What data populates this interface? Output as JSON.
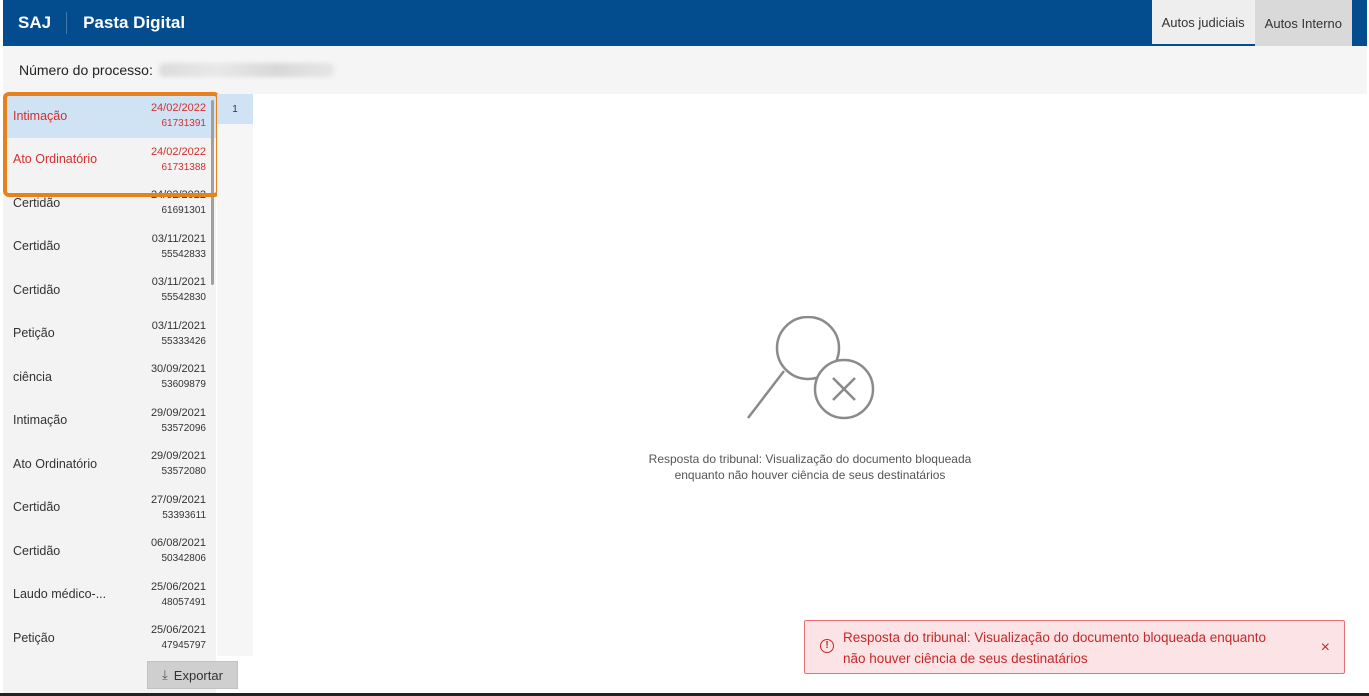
{
  "header": {
    "brand": "SAJ",
    "title": "Pasta Digital",
    "tabs": [
      {
        "label": "Autos judiciais",
        "active": true
      },
      {
        "label": "Autos Interno",
        "active": false
      }
    ],
    "color": "#034d8e"
  },
  "process": {
    "label": "Número do processo:",
    "value_redacted": true
  },
  "documents": [
    {
      "label": "Intimação",
      "date": "24/02/2022",
      "id": "61731391",
      "selected": true,
      "red": true
    },
    {
      "label": "Ato Ordinatório",
      "date": "24/02/2022",
      "id": "61731388",
      "selected": false,
      "red": true
    },
    {
      "label": "Certidão",
      "date": "24/02/2022",
      "id": "61691301",
      "selected": false,
      "red": false
    },
    {
      "label": "Certidão",
      "date": "03/11/2021",
      "id": "55542833",
      "selected": false,
      "red": false
    },
    {
      "label": "Certidão",
      "date": "03/11/2021",
      "id": "55542830",
      "selected": false,
      "red": false
    },
    {
      "label": "Petição",
      "date": "03/11/2021",
      "id": "55333426",
      "selected": false,
      "red": false
    },
    {
      "label": "ciência",
      "date": "30/09/2021",
      "id": "53609879",
      "selected": false,
      "red": false
    },
    {
      "label": "Intimação",
      "date": "29/09/2021",
      "id": "53572096",
      "selected": false,
      "red": false
    },
    {
      "label": "Ato Ordinatório",
      "date": "29/09/2021",
      "id": "53572080",
      "selected": false,
      "red": false
    },
    {
      "label": "Certidão",
      "date": "27/09/2021",
      "id": "53393611",
      "selected": false,
      "red": false
    },
    {
      "label": "Certidão",
      "date": "06/08/2021",
      "id": "50342806",
      "selected": false,
      "red": false
    },
    {
      "label": "Laudo médico-...",
      "date": "25/06/2021",
      "id": "48057491",
      "selected": false,
      "red": false
    },
    {
      "label": "Petição",
      "date": "25/06/2021",
      "id": "47945797",
      "selected": false,
      "red": false
    }
  ],
  "pages": {
    "current": "1"
  },
  "export": {
    "label": "Exportar",
    "icon": "download-icon"
  },
  "viewer": {
    "icon": "search-blocked-icon",
    "message_line1": "Resposta do tribunal: Visualização do documento bloqueada",
    "message_line2": "enquanto não houver ciência de seus destinatários"
  },
  "toast": {
    "icon": "alert-circle-icon",
    "message_line1": "Resposta do tribunal: Visualização do documento bloqueada enquanto",
    "message_line2": "não houver ciência de seus destinatários",
    "close": "×",
    "color": "#c62828"
  },
  "highlight_color": "#e7811b"
}
